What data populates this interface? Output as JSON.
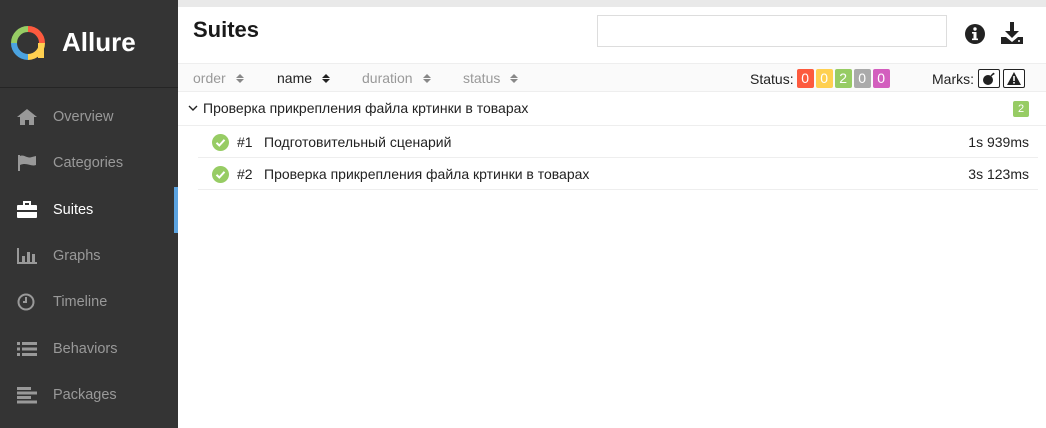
{
  "brand": {
    "name": "Allure"
  },
  "nav": {
    "items": [
      {
        "label": "Overview",
        "icon": "home-icon"
      },
      {
        "label": "Categories",
        "icon": "flag-icon"
      },
      {
        "label": "Suites",
        "icon": "briefcase-icon",
        "active": true
      },
      {
        "label": "Graphs",
        "icon": "bar-chart-icon"
      },
      {
        "label": "Timeline",
        "icon": "clock-icon"
      },
      {
        "label": "Behaviors",
        "icon": "list-icon"
      },
      {
        "label": "Packages",
        "icon": "align-left-icon"
      }
    ]
  },
  "page": {
    "title": "Suites",
    "search_value": ""
  },
  "toolbar": {
    "sort": [
      {
        "label": "order"
      },
      {
        "label": "name",
        "active": true
      },
      {
        "label": "duration"
      },
      {
        "label": "status"
      }
    ],
    "status_label": "Status:",
    "status_counts": [
      {
        "value": "0",
        "color": "#fd5a3e"
      },
      {
        "value": "0",
        "color": "#ffd050"
      },
      {
        "value": "2",
        "color": "#97cc64"
      },
      {
        "value": "0",
        "color": "#aaaaaa"
      },
      {
        "value": "0",
        "color": "#d35ebe"
      }
    ],
    "marks_label": "Marks:",
    "marks": [
      {
        "icon": "bomb-icon"
      },
      {
        "icon": "warning-icon"
      }
    ]
  },
  "suite": {
    "title": "Проверка прикрепления файла кртинки в товарах",
    "count": "2",
    "tests": [
      {
        "num": "#1",
        "name": "Подготовительный сценарий",
        "duration": "1s 939ms"
      },
      {
        "num": "#2",
        "name": "Проверка прикрепления файла кртинки в товарах",
        "duration": "3s 123ms"
      }
    ]
  },
  "colors": {
    "sidebar_bg": "#343434",
    "active_accent": "#5ba3e0",
    "passed": "#97cc64"
  }
}
